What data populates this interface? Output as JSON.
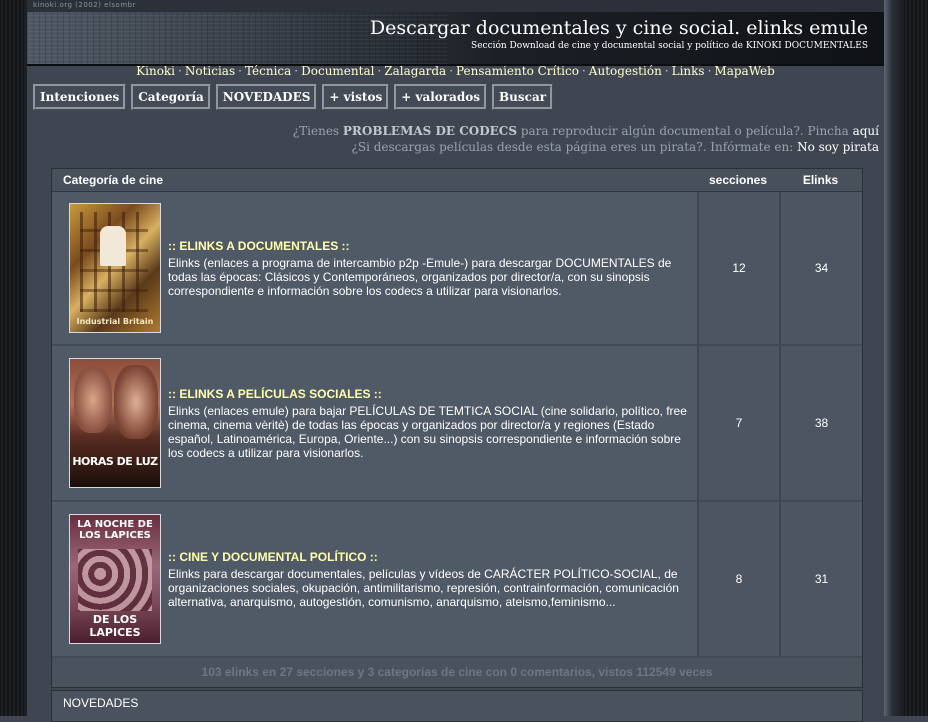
{
  "topstrip": {
    "text": "kinoki.org (2002) elsombr"
  },
  "banner": {
    "title": "Descargar documentales y cine social. elinks emule",
    "subtitle": "Sección Download de cine y documental social y político de KINOKI DOCUMENTALES"
  },
  "nav": [
    "Kinoki",
    "Noticias",
    "Técnica",
    "Documental",
    "Zalagarda",
    "Pensamiento Crítico",
    "Autogestión",
    "Links",
    "MapaWeb"
  ],
  "buttons": [
    "Intenciones",
    "Categoría",
    "NOVEDADES",
    "+ vistos",
    "+ valorados",
    "Buscar"
  ],
  "notice1": {
    "pre": "¿Tienes ",
    "bold": "PROBLEMAS DE CODECS",
    "mid": " para reproducir algún documental o película?. Pincha ",
    "link": "aquí"
  },
  "notice2": {
    "pre": "¿Si descargas películas desde esta página eres un pirata?. Infórmate en: ",
    "link": "No soy pirata"
  },
  "table": {
    "headers": {
      "category": "Categoría de cine",
      "sections": "secciones",
      "elinks": "Elinks"
    },
    "rows": [
      {
        "title": ":: ELINKS A DOCUMENTALES ::",
        "desc": "Elinks (enlaces a programa de intercambio p2p -Emule-) para descargar DOCUMENTALES de todas las épocas: Clásicos y Contemporáneos, organizados por director/a, con su sinopsis correspondiente e información sobre los codecs a utilizar para visionarlos.",
        "sections": "12",
        "elinks": "34",
        "poster_text": "Industrial Britain"
      },
      {
        "title": ":: ELINKS A PELÍCULAS SOCIALES ::",
        "desc": "Elinks (enlaces emule) para bajar PELÍCULAS DE TEMTICA SOCIAL (cine solidario, político, free cinema, cinema vèritè) de todas las épocas y organizados por director/a y regiones (Estado español, Latinoamérica, Europa, Oriente...) con su sinopsis correspondiente e información sobre los codecs a utilizar para visionarlos.",
        "sections": "7",
        "elinks": "38",
        "poster_text": "HORAS DE LUZ"
      },
      {
        "title": ":: CINE Y DOCUMENTAL POLÍTICO ::",
        "desc": "Elinks para descargar documentales, películas y vídeos de CARÁCTER POLÍTICO-SOCIAL, de organizaciones sociales, okupación, antimilitarismo, represión, contrainformación, comunicación alternativa, anarquismo, autogestión, comunismo, anarquismo, ateismo,feminismo...",
        "sections": "8",
        "elinks": "31",
        "poster_text_top": "LA NOCHE DE LOS LAPICES",
        "poster_text_bottom": "DE LOS LAPICES"
      }
    ],
    "stats": "103 elinks en 27 secciones y 3 categorías de cine con 0 comentarios, vistos 112549 veces"
  },
  "novedades_header": "NOVEDADES",
  "colors": {
    "link": "#ffffcc",
    "title_yellow": "#ffffaa",
    "background": "#3f4651"
  }
}
